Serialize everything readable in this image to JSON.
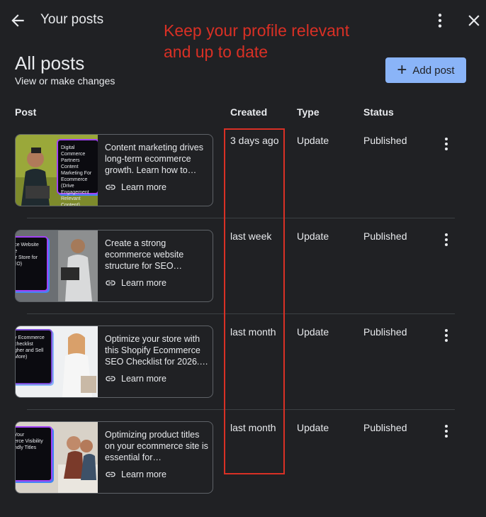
{
  "header": {
    "title": "Your posts",
    "icons": {
      "back": "arrow-back-icon",
      "more": "more-vert-icon",
      "close": "close-icon"
    }
  },
  "annotation": {
    "text": "Keep your profile relevant\nand up to date",
    "color": "#d93025"
  },
  "main": {
    "heading": "All posts",
    "subheading": "View or make changes",
    "add_button": {
      "label": "Add post",
      "icon": "plus-icon",
      "color": "#8ab4f8"
    }
  },
  "table": {
    "columns": [
      "Post",
      "Created",
      "Type",
      "Status"
    ],
    "learn_more_label": "Learn more",
    "rows": [
      {
        "snippet": "Content marketing drives long-term ecommerce growth. Learn how to…",
        "thumb_text": "Digital Commerce Partners\nContent Marketing For Ecommerce\n(Drive Engagement Relevant Content)",
        "created": "3 days ago",
        "type": "Update",
        "status": "Published"
      },
      {
        "snippet": "Create a strong ecommerce website structure for SEO…",
        "thumb_text": "erce Website\nure\nour Store for SEO)",
        "created": "last week",
        "type": "Update",
        "status": "Published"
      },
      {
        "snippet": "Optimize your store with this Shopify Ecommerce SEO Checklist for 2026.…",
        "thumb_text": "y Ecommerce\nchecklist\ngher and Sell More)",
        "created": "last month",
        "type": "Update",
        "status": "Published"
      },
      {
        "snippet": "Optimizing product titles on your ecommerce site is essential for…",
        "thumb_text": "Your\nerce Visibility\nndly Titles",
        "created": "last month",
        "type": "Update",
        "status": "Published"
      }
    ]
  },
  "colors": {
    "background": "#202124",
    "text": "#e8eaed",
    "border": "#5f6368",
    "highlight": "#d93025"
  }
}
